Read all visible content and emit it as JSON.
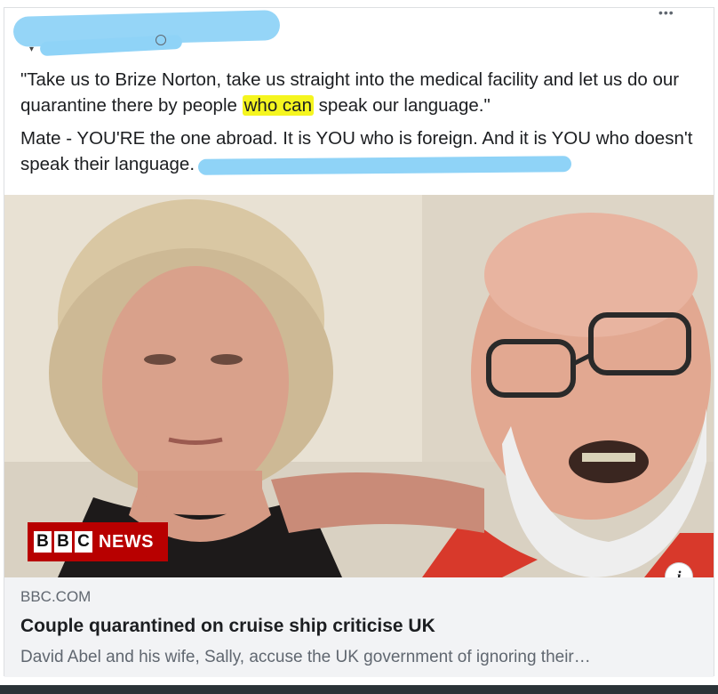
{
  "post": {
    "paragraph1_part1": "\"Take us to Brize Norton, take us straight into the medical facility and let us do our quarantine there by people ",
    "paragraph1_highlight": "who can",
    "paragraph1_part2": " speak our language.\"",
    "paragraph2": "Mate - YOU'RE the one abroad. It is YOU who is foreign. And it is YOU who doesn't speak their language.",
    "highlight_color": "#f5f51f",
    "redaction_color": "#8fd3f7"
  },
  "header": {
    "more_icon": "more-dots-icon",
    "more_glyph": "•••"
  },
  "media": {
    "logo_letters": [
      "B",
      "B",
      "C"
    ],
    "logo_news": "NEWS",
    "logo_color": "#b80000",
    "info_glyph": "i"
  },
  "link_preview": {
    "domain": "BBC.COM",
    "headline": "Couple quarantined on cruise ship criticise UK",
    "description": "David Abel and his wife, Sally, accuse the UK government of ignoring their…"
  }
}
